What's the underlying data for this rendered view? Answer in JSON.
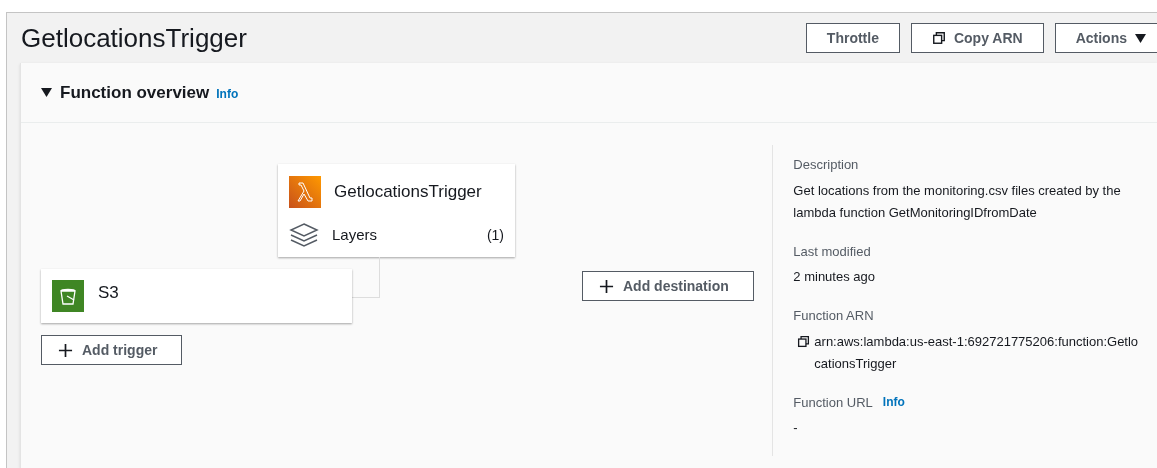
{
  "page": {
    "title": "GetlocationsTrigger",
    "buttons": [
      {
        "label": "Throttle",
        "kind": "plain"
      },
      {
        "label": "Copy ARN",
        "kind": "copy"
      },
      {
        "label": "Actions",
        "kind": "dropdown"
      }
    ]
  },
  "overview": {
    "title": "Function overview",
    "info": "Info",
    "expanded": true,
    "function_node": {
      "name": "GetlocationsTrigger",
      "layers_label": "Layers",
      "layers_count": "(1)"
    },
    "triggers": [
      {
        "name": "S3"
      }
    ],
    "add_trigger": "Add trigger",
    "add_destination": "Add destination",
    "details": [
      {
        "kind": "text",
        "label": "Description",
        "value": "Get locations from the monitoring.csv files created by the lambda function GetMonitoringIDfromDate"
      },
      {
        "kind": "text",
        "label": "Last modified",
        "value": "2 minutes ago"
      },
      {
        "kind": "copy",
        "label": "Function ARN",
        "value": "arn:aws:lambda:us-east-1:692721775206:function:GetlocationsTrigger"
      },
      {
        "kind": "info",
        "label": "Function URL",
        "info": "Info",
        "value": "-"
      }
    ]
  }
}
